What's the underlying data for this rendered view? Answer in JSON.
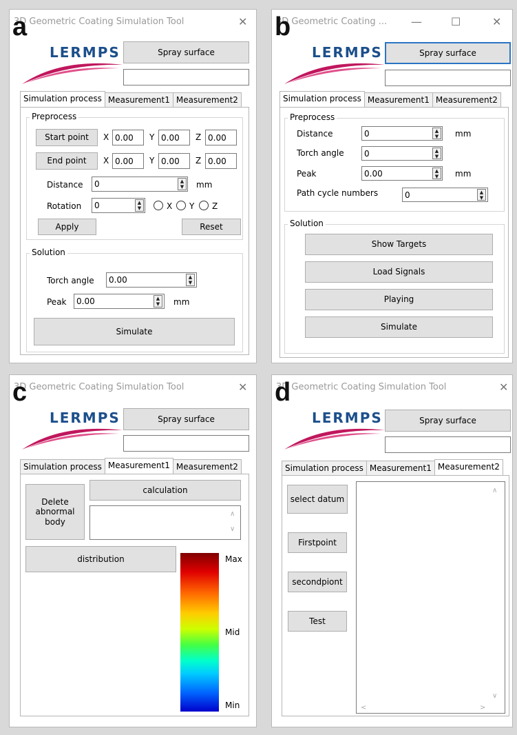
{
  "common": {
    "app_title": "3D Geometric Coating Simulation Tool",
    "app_title_short": "3D Geometric Coating ...",
    "logo_text": "LERMPS",
    "spray_surface": "Spray surface",
    "tabs": [
      "Simulation process",
      "Measurement1",
      "Measurement2"
    ],
    "close_glyph": "✕",
    "min_glyph": "—",
    "max_glyph": "☐"
  },
  "panel_a": {
    "letter": "a",
    "preprocess_title": "Preprocess",
    "start_point": "Start point",
    "end_point": "End point",
    "x": "X",
    "y": "Y",
    "z": "Z",
    "start_x": "0.00",
    "start_y": "0.00",
    "start_z": "0.00",
    "end_x": "0.00",
    "end_y": "0.00",
    "end_z": "0.00",
    "distance_label": "Distance",
    "distance_value": "0",
    "mm": "mm",
    "rotation_label": "Rotation",
    "rotation_value": "0",
    "radio_x": "X",
    "radio_y": "Y",
    "radio_z": "Z",
    "apply": "Apply",
    "reset": "Reset",
    "solution_title": "Solution",
    "torch_angle_label": "Torch angle",
    "torch_angle_value": "0.00",
    "peak_label": "Peak",
    "peak_value": "0.00",
    "simulate": "Simulate"
  },
  "panel_b": {
    "letter": "b",
    "preprocess_title": "Preprocess",
    "distance_label": "Distance",
    "distance_value": "0",
    "torch_angle_label": "Torch angle",
    "torch_angle_value": "0",
    "peak_label": "Peak",
    "peak_value": "0.00",
    "mm": "mm",
    "path_cycle_label": "Path cycle numbers",
    "path_cycle_value": "0",
    "solution_title": "Solution",
    "show_targets": "Show Targets",
    "load_signals": "Load Signals",
    "playing": "Playing",
    "simulate": "Simulate"
  },
  "panel_c": {
    "letter": "c",
    "delete_abnormal": "Delete abnormal body",
    "calculation": "calculation",
    "distribution": "distribution",
    "scale_max": "Max",
    "scale_mid": "Mid",
    "scale_min": "Min"
  },
  "panel_d": {
    "letter": "d",
    "select_datum": "select datum",
    "firstpoint": "Firstpoint",
    "secondpiont": "secondpiont",
    "test": "Test"
  }
}
